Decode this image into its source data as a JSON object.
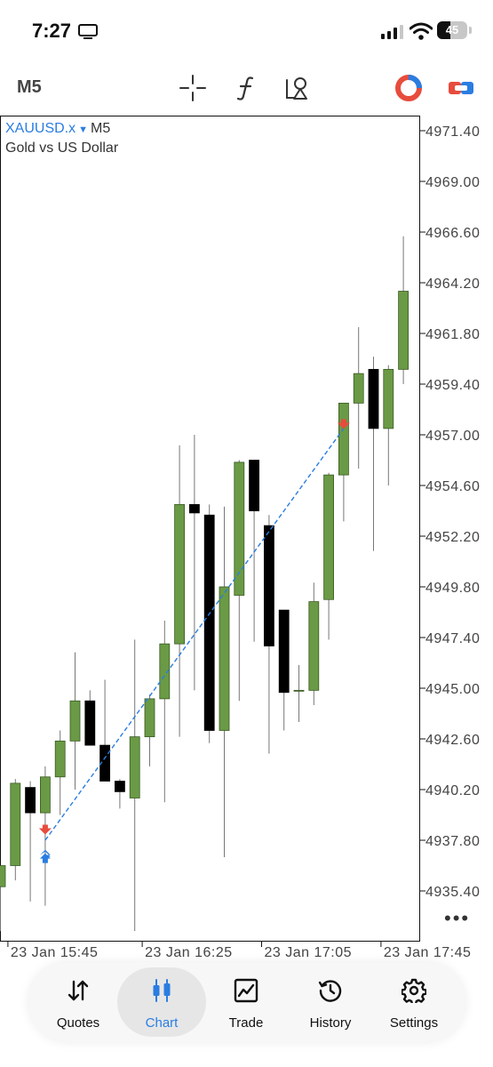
{
  "status_bar": {
    "time": "7:27",
    "battery": "45",
    "battery_level": 0.45
  },
  "toolbar": {
    "timeframe": "M5",
    "icons": [
      "crosshair-icon",
      "indicators-function-icon",
      "objects-shapes-icon",
      "trading-account-icon",
      "one-click-trading-icon"
    ]
  },
  "symbol": {
    "name": "XAUUSD.x",
    "timeframe": "M5",
    "description": "Gold vs US Dollar"
  },
  "colors": {
    "bull": "#6a9a45",
    "bear": "#000000",
    "trendline": "#2a7de1",
    "sell_arrow": "#e74c3c",
    "buy_arrow": "#2a7de1",
    "accent": "#2a7de1"
  },
  "chart_data": {
    "type": "candlestick",
    "symbol": "XAUUSD.x",
    "timeframe": "M5",
    "price_ticks": [
      "4971.40",
      "4969.00",
      "4966.60",
      "4964.20",
      "4961.80",
      "4959.40",
      "4957.00",
      "4954.60",
      "4952.20",
      "4949.80",
      "4947.40",
      "4945.00",
      "4942.60",
      "4940.20",
      "4937.80",
      "4935.40"
    ],
    "ylim": [
      4933.5,
      4972.5
    ],
    "time_ticks": [
      "23 Jan 15:45",
      "23 Jan 16:25",
      "23 Jan 17:05",
      "23 Jan 17:45"
    ],
    "time_tick_indices": [
      0.5,
      9.5,
      17.5,
      25.5
    ],
    "candles": [
      {
        "o": 4935.6,
        "h": 4936.4,
        "l": 4933.5,
        "c": 4936.6
      },
      {
        "o": 4936.6,
        "h": 4940.7,
        "l": 4935.9,
        "c": 4940.5
      },
      {
        "o": 4940.3,
        "h": 4940.6,
        "l": 4934.9,
        "c": 4939.1
      },
      {
        "o": 4939.1,
        "h": 4941.3,
        "l": 4934.7,
        "c": 4940.8
      },
      {
        "o": 4940.8,
        "h": 4943.0,
        "l": 4939.0,
        "c": 4942.5
      },
      {
        "o": 4942.5,
        "h": 4946.7,
        "l": 4940.2,
        "c": 4944.4
      },
      {
        "o": 4944.4,
        "h": 4944.9,
        "l": 4942.3,
        "c": 4942.3
      },
      {
        "o": 4942.3,
        "h": 4945.4,
        "l": 4940.8,
        "c": 4940.6
      },
      {
        "o": 4940.6,
        "h": 4940.7,
        "l": 4939.3,
        "c": 4940.1
      },
      {
        "o": 4939.8,
        "h": 4947.3,
        "l": 4933.5,
        "c": 4942.7
      },
      {
        "o": 4942.7,
        "h": 4944.7,
        "l": 4941.3,
        "c": 4944.5
      },
      {
        "o": 4944.5,
        "h": 4948.2,
        "l": 4939.6,
        "c": 4947.1
      },
      {
        "o": 4947.1,
        "h": 4956.5,
        "l": 4942.7,
        "c": 4953.7
      },
      {
        "o": 4953.7,
        "h": 4957.0,
        "l": 4944.9,
        "c": 4953.3
      },
      {
        "o": 4953.2,
        "h": 4953.7,
        "l": 4942.4,
        "c": 4943.0
      },
      {
        "o": 4943.0,
        "h": 4953.6,
        "l": 4937.0,
        "c": 4949.8
      },
      {
        "o": 4949.4,
        "h": 4955.8,
        "l": 4944.4,
        "c": 4955.7
      },
      {
        "o": 4955.8,
        "h": 4955.8,
        "l": 4947.2,
        "c": 4953.4
      },
      {
        "o": 4952.7,
        "h": 4953.2,
        "l": 4941.9,
        "c": 4947.0
      },
      {
        "o": 4948.7,
        "h": 4948.7,
        "l": 4943.0,
        "c": 4944.8
      },
      {
        "o": 4944.9,
        "h": 4946.1,
        "l": 4943.4,
        "c": 4944.9
      },
      {
        "o": 4944.9,
        "h": 4950.0,
        "l": 4944.2,
        "c": 4949.1
      },
      {
        "o": 4949.2,
        "h": 4955.2,
        "l": 4947.3,
        "c": 4955.1
      },
      {
        "o": 4955.1,
        "h": 4958.3,
        "l": 4952.9,
        "c": 4958.5
      },
      {
        "o": 4958.5,
        "h": 4962.1,
        "l": 4955.4,
        "c": 4959.9
      },
      {
        "o": 4960.1,
        "h": 4960.7,
        "l": 4951.5,
        "c": 4957.3
      },
      {
        "o": 4957.3,
        "h": 4960.3,
        "l": 4954.6,
        "c": 4960.1
      },
      {
        "o": 4960.1,
        "h": 4966.4,
        "l": 4959.4,
        "c": 4963.8
      }
    ],
    "trades": [
      {
        "from_index": 3,
        "from_price": 4937.8,
        "to_index": 23,
        "to_price": 4957.3
      }
    ],
    "markers": [
      {
        "type": "sell-arrow",
        "index": 3,
        "price": 4938.2
      },
      {
        "type": "buy-arrow",
        "index": 3,
        "price": 4937.1
      },
      {
        "type": "sell-arrow",
        "index": 23,
        "price": 4957.4
      }
    ],
    "grid": false
  },
  "tabs": [
    {
      "label": "Quotes",
      "icon": "quotes-arrows-icon",
      "active": false
    },
    {
      "label": "Chart",
      "icon": "chart-candles-icon",
      "active": true
    },
    {
      "label": "Trade",
      "icon": "trade-chart-icon",
      "active": false
    },
    {
      "label": "History",
      "icon": "history-clock-icon",
      "active": false
    },
    {
      "label": "Settings",
      "icon": "settings-gear-icon",
      "active": false
    }
  ],
  "more_label": "•••"
}
